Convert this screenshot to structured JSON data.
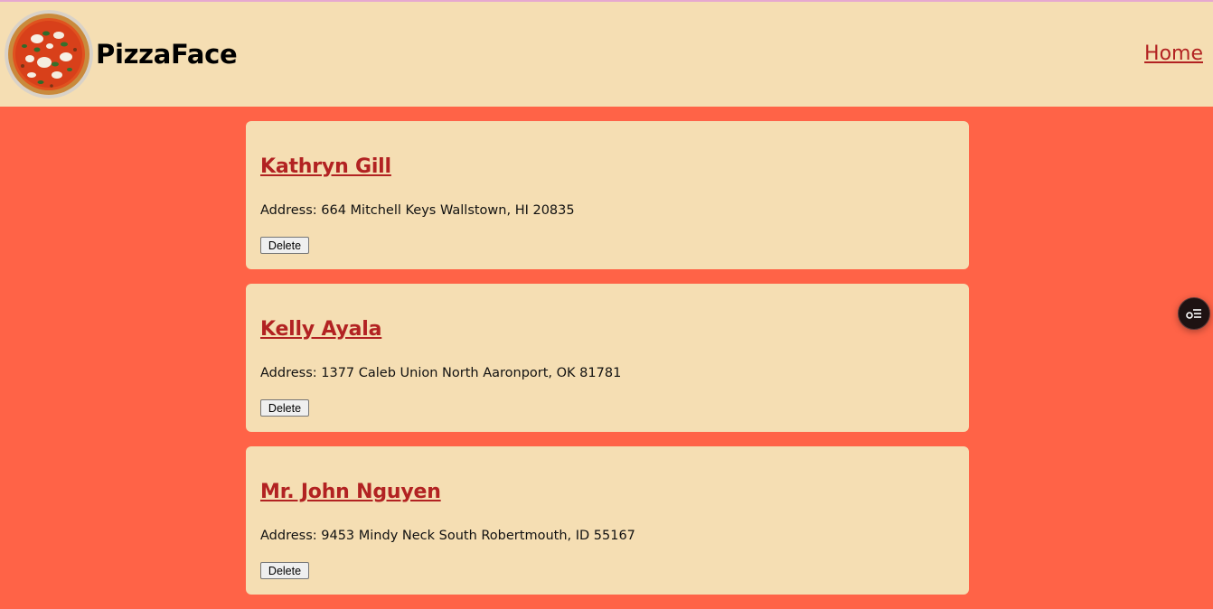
{
  "header": {
    "brand": "PizzaFace",
    "nav_home": "Home"
  },
  "address_label": "Address:",
  "delete_label": "Delete",
  "customers": [
    {
      "name": "Kathryn Gill",
      "address": "664 Mitchell Keys Wallstown, HI 20835"
    },
    {
      "name": "Kelly Ayala",
      "address": "1377 Caleb Union North Aaronport, OK 81781"
    },
    {
      "name": "Mr. John Nguyen",
      "address": "9453 Mindy Neck South Robertmouth, ID 55167"
    }
  ],
  "colors": {
    "page_bg": "#ff6347",
    "header_bg": "#f5deb3",
    "link": "#b22222"
  },
  "icons": {
    "logo": "pizza-logo-icon",
    "floating": "settings-list-icon"
  }
}
